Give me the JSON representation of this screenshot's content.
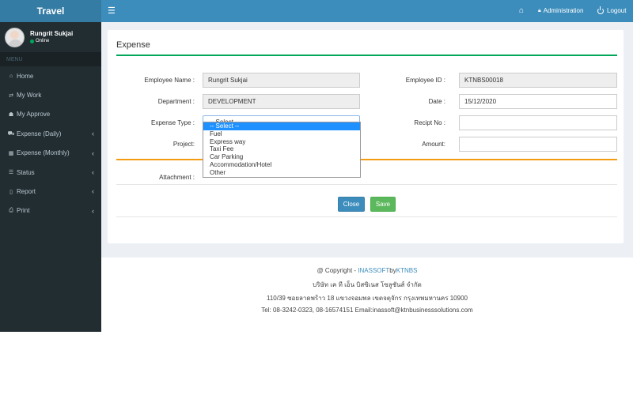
{
  "brand": "Travel",
  "user": {
    "name": "Rungrit Sukjai",
    "status": "Online"
  },
  "menu": {
    "header": "MENU",
    "items": [
      {
        "label": "Home",
        "icon": "home-icon",
        "has_arrow": false
      },
      {
        "label": "My Work",
        "icon": "exchange-icon",
        "has_arrow": false
      },
      {
        "label": "My Approve",
        "icon": "sitemap-icon",
        "has_arrow": false
      },
      {
        "label": "Expense (Daily)",
        "icon": "car-icon",
        "has_arrow": true
      },
      {
        "label": "Expense (Monthly)",
        "icon": "calendar-icon",
        "has_arrow": true
      },
      {
        "label": "Status",
        "icon": "list-icon",
        "has_arrow": true
      },
      {
        "label": "Report",
        "icon": "file-icon",
        "has_arrow": true
      },
      {
        "label": "Print",
        "icon": "print-icon",
        "has_arrow": true
      }
    ]
  },
  "topbar": {
    "admin_label": "Administration",
    "logout_label": "Logout"
  },
  "form": {
    "title": "Expense",
    "employee_name_label": "Employee Name :",
    "employee_name_value": "Rungrit Sukjai",
    "employee_id_label": "Employee ID :",
    "employee_id_value": "KTNBS00018",
    "department_label": "Department :",
    "department_value": "DEVELOPMENT",
    "date_label": "Date :",
    "date_value": "15/12/2020",
    "expense_type_label": "Expense Type :",
    "expense_type_selected": "-- Select --",
    "expense_type_options": [
      "-- Select --",
      "Fuel",
      "Express way",
      "Taxi Fee",
      "Car Parking",
      "Accommodation/Hotel",
      "Other"
    ],
    "receipt_label": "Recipt No :",
    "project_label": "Project:",
    "amount_label": "Amount:",
    "attachment_label": "Attachment :",
    "close_label": "Close",
    "save_label": "Save"
  },
  "footer": {
    "copyright_prefix": "@ Copyright - ",
    "copyright_link1": "INASSOFT",
    "copyright_by": "by",
    "copyright_link2": "KTNBS",
    "company": "บริษัท เค ที เอ็น บิสซิเนส โซลูชันส์ จำกัด",
    "address": "110/39 ซอยลาดพร้าว 18 แขวงจอมพล เขตจตุจักร กรุงเทพมหานคร 10900",
    "contact": "Tel: 08-3242-0323, 08-16574151 Email:inassoft@ktnbusinesssolutions.com"
  }
}
